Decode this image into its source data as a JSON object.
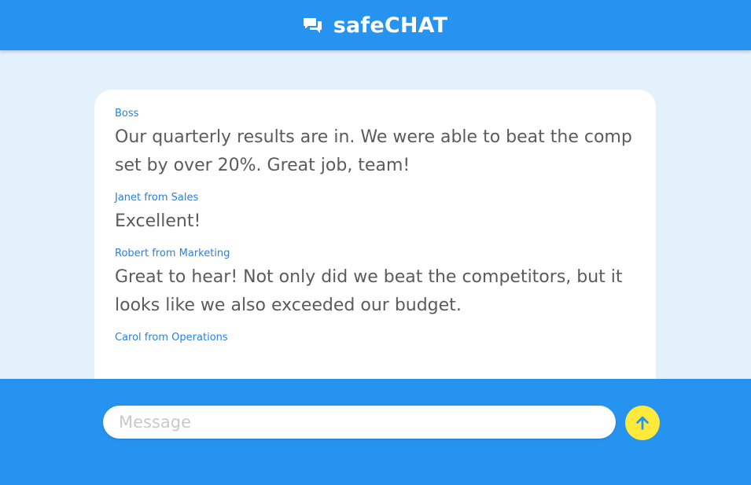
{
  "app": {
    "title": "safeCHAT",
    "logo_icon": "chat-bubbles-icon"
  },
  "colors": {
    "header_bg": "#2793f0",
    "page_bg": "#e3f1fd",
    "sender_color": "#2a80df",
    "text_color": "#5b5b5b",
    "send_button_bg": "#ffea3b",
    "send_arrow": "#2793f0"
  },
  "messages": [
    {
      "sender": "Boss",
      "text": "Our quarterly results are in. We were able to beat the comp set by over 20%. Great job, team!"
    },
    {
      "sender": "Janet from Sales",
      "text": "Excellent!"
    },
    {
      "sender": "Robert from Marketing",
      "text": "Great to hear! Not only did we beat the competitors, but it looks like we also exceeded our budget."
    },
    {
      "sender": "Carol from Operations",
      "text": ""
    }
  ],
  "composer": {
    "placeholder": "Message",
    "value": "",
    "send_icon": "arrow-up-icon"
  }
}
